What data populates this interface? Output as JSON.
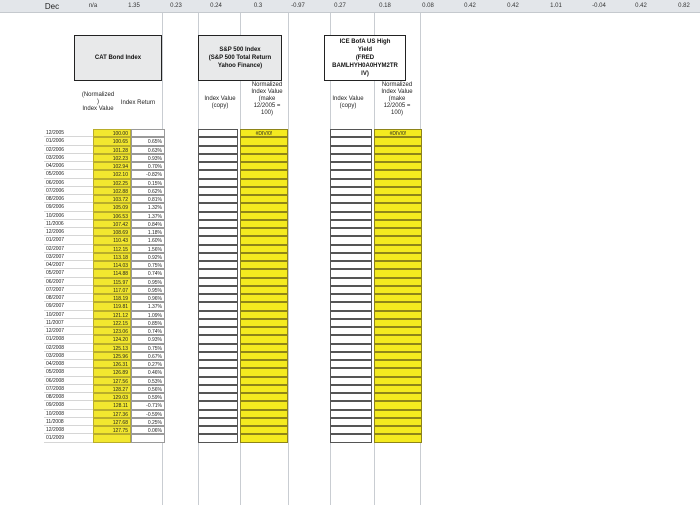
{
  "top_row": [
    "Dec",
    "n/a",
    "1.35",
    "0.23",
    "0.24",
    "0.3",
    "-0.97",
    "0.27",
    "0.18",
    "0.08",
    "0.42",
    "0.42",
    "1.01",
    "-0.04",
    "0.42",
    "0.82"
  ],
  "headers": {
    "cat_bond": "CAT Bond Index",
    "sp500": "S&P 500 Index\n(S&P 500 Total Return\nYahoo Finance)",
    "hy": "ICE BofA US High\nYield\n(FRED\nBAMLHYH0A0HYM2TR\nIV)"
  },
  "subheaders": {
    "cat_norm": "(Normalized\n)\nIndex Value",
    "cat_ret": "Index Return",
    "sp_val": "Index Value\n(copy)",
    "sp_norm": "Normalized\nIndex Value\n(make\n12/2005 =\n100)",
    "hy_val": "Index Value\n(copy)",
    "hy_norm": "Normalized\nIndex Value\n(make\n12/2005 =\n100)"
  },
  "error_value": "#DIV/0!",
  "rows": [
    {
      "date": "12/2005",
      "idx": "100.00",
      "ret": ""
    },
    {
      "date": "01/2006",
      "idx": "100.65",
      "ret": "0.65%"
    },
    {
      "date": "02/2006",
      "idx": "101.28",
      "ret": "0.63%"
    },
    {
      "date": "03/2006",
      "idx": "102.23",
      "ret": "0.93%"
    },
    {
      "date": "04/2006",
      "idx": "102.94",
      "ret": "0.70%"
    },
    {
      "date": "05/2006",
      "idx": "102.10",
      "ret": "-0.82%"
    },
    {
      "date": "06/2006",
      "idx": "102.25",
      "ret": "0.15%"
    },
    {
      "date": "07/2006",
      "idx": "102.88",
      "ret": "0.62%"
    },
    {
      "date": "08/2006",
      "idx": "103.72",
      "ret": "0.81%"
    },
    {
      "date": "09/2006",
      "idx": "105.09",
      "ret": "1.32%"
    },
    {
      "date": "10/2006",
      "idx": "106.53",
      "ret": "1.37%"
    },
    {
      "date": "11/2006",
      "idx": "107.42",
      "ret": "0.84%"
    },
    {
      "date": "12/2006",
      "idx": "108.69",
      "ret": "1.18%"
    },
    {
      "date": "01/2007",
      "idx": "110.43",
      "ret": "1.60%"
    },
    {
      "date": "02/2007",
      "idx": "112.15",
      "ret": "1.56%"
    },
    {
      "date": "03/2007",
      "idx": "113.18",
      "ret": "0.92%"
    },
    {
      "date": "04/2007",
      "idx": "114.03",
      "ret": "0.75%"
    },
    {
      "date": "05/2007",
      "idx": "114.88",
      "ret": "0.74%"
    },
    {
      "date": "06/2007",
      "idx": "115.97",
      "ret": "0.95%"
    },
    {
      "date": "07/2007",
      "idx": "117.07",
      "ret": "0.95%"
    },
    {
      "date": "08/2007",
      "idx": "118.19",
      "ret": "0.96%"
    },
    {
      "date": "09/2007",
      "idx": "119.81",
      "ret": "1.37%"
    },
    {
      "date": "10/2007",
      "idx": "121.12",
      "ret": "1.09%"
    },
    {
      "date": "11/2007",
      "idx": "122.15",
      "ret": "0.85%"
    },
    {
      "date": "12/2007",
      "idx": "123.06",
      "ret": "0.74%"
    },
    {
      "date": "01/2008",
      "idx": "124.20",
      "ret": "0.93%"
    },
    {
      "date": "02/2008",
      "idx": "125.13",
      "ret": "0.75%"
    },
    {
      "date": "03/2008",
      "idx": "125.96",
      "ret": "0.67%"
    },
    {
      "date": "04/2008",
      "idx": "126.31",
      "ret": "0.27%"
    },
    {
      "date": "05/2008",
      "idx": "126.89",
      "ret": "0.46%"
    },
    {
      "date": "06/2008",
      "idx": "127.56",
      "ret": "0.53%"
    },
    {
      "date": "07/2008",
      "idx": "128.27",
      "ret": "0.56%"
    },
    {
      "date": "08/2008",
      "idx": "129.03",
      "ret": "0.59%"
    },
    {
      "date": "09/2008",
      "idx": "128.11",
      "ret": "-0.71%"
    },
    {
      "date": "10/2008",
      "idx": "127.36",
      "ret": "-0.59%"
    },
    {
      "date": "11/2008",
      "idx": "127.68",
      "ret": "0.25%"
    },
    {
      "date": "12/2008",
      "idx": "127.75",
      "ret": "0.06%"
    },
    {
      "date": "01/2009",
      "idx": "",
      "ret": ""
    }
  ]
}
